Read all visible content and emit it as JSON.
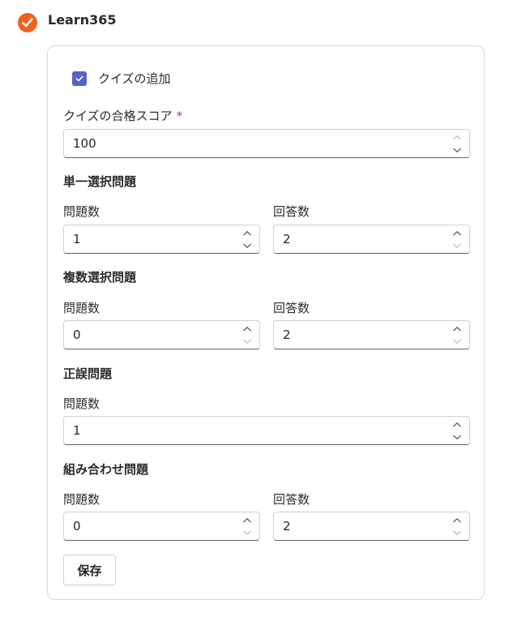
{
  "app": {
    "title": "Learn365",
    "brand_color": "#f0601e",
    "logo_icon": "checkmark-swoosh-icon"
  },
  "quiz": {
    "add_quiz_label": "クイズの追加",
    "add_quiz_checked": true,
    "checkbox_color": "#5b5fc7",
    "pass_score_label": "クイズの合格スコア",
    "required_marker": "*",
    "pass_score_value": "100"
  },
  "single_choice": {
    "title": "単一選択問題",
    "questions_label": "問題数",
    "questions_value": "1",
    "answers_label": "回答数",
    "answers_value": "2"
  },
  "multiple_choice": {
    "title": "複数選択問題",
    "questions_label": "問題数",
    "questions_value": "0",
    "answers_label": "回答数",
    "answers_value": "2"
  },
  "true_false": {
    "title": "正誤問題",
    "questions_label": "問題数",
    "questions_value": "1"
  },
  "matching": {
    "title": "組み合わせ問題",
    "questions_label": "問題数",
    "questions_value": "0",
    "answers_label": "回答数",
    "answers_value": "2"
  },
  "actions": {
    "save_label": "保存"
  }
}
